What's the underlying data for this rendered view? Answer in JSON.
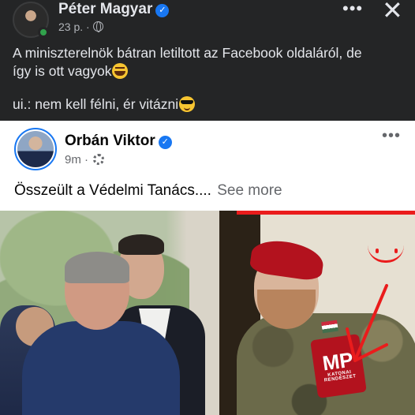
{
  "outer_post": {
    "author_name": "Péter Magyar",
    "verified_symbol": "✓",
    "time": "23 p.",
    "separator": "·",
    "more_label": "•••",
    "close_label": "✕",
    "line1": "A miniszterelnök bátran letiltott az Facebook oldaláról, de",
    "line2": "így is ott vagyok",
    "line3": "ui.: nem kell félni, ér vitázni",
    "emoji1": "face-with-tears-of-joy-emoji",
    "emoji2": "sunglasses-emoji"
  },
  "shared_post": {
    "author_name": "Orbán Viktor",
    "verified_symbol": "✓",
    "time": "9m",
    "separator": "·",
    "more_label": "•••",
    "text": "Összeült a Védelmi Tanács....",
    "see_more": "See more",
    "photo_patch": {
      "big": "MP",
      "small": "KATONAI RENDÉSZET"
    }
  },
  "colors": {
    "dark_bg": "#242526",
    "verified_blue": "#1877f2",
    "annotation_red": "#ea1c1c",
    "online_green": "#31a24c"
  }
}
